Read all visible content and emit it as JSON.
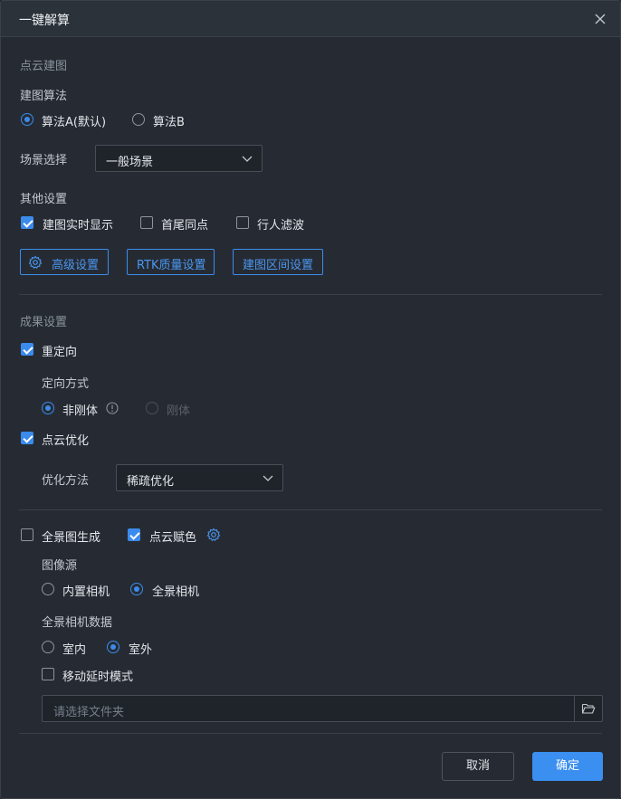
{
  "dialog": {
    "title": "一键解算"
  },
  "pointcloud": {
    "section": "点云建图",
    "algo_label": "建图算法",
    "algo_a": "算法A(默认)",
    "algo_b": "算法B",
    "scene_label": "场景选择",
    "scene_value": "一般场景",
    "other_label": "其他设置",
    "realtime": "建图实时显示",
    "loop": "首尾同点",
    "pedestrian": "行人滤波",
    "btn_advanced": "高级设置",
    "btn_rtk": "RTK质量设置",
    "btn_range": "建图区间设置"
  },
  "result": {
    "section": "成果设置",
    "reorient": "重定向",
    "orient_method_label": "定向方式",
    "nonrigid": "非刚体",
    "rigid": "刚体",
    "optimize": "点云优化",
    "opt_method_label": "优化方法",
    "opt_method_value": "稀疏优化"
  },
  "pano": {
    "generate": "全景图生成",
    "colorize": "点云赋色",
    "source_label": "图像源",
    "builtin": "内置相机",
    "panocam": "全景相机",
    "data_label": "全景相机数据",
    "indoor": "室内",
    "outdoor": "室外",
    "delay_mode": "移动延时模式",
    "folder_placeholder": "请选择文件夹"
  },
  "footer": {
    "cancel": "取消",
    "ok": "确定"
  },
  "colors": {
    "accent": "#3b8bec",
    "bg": "#262b33"
  }
}
